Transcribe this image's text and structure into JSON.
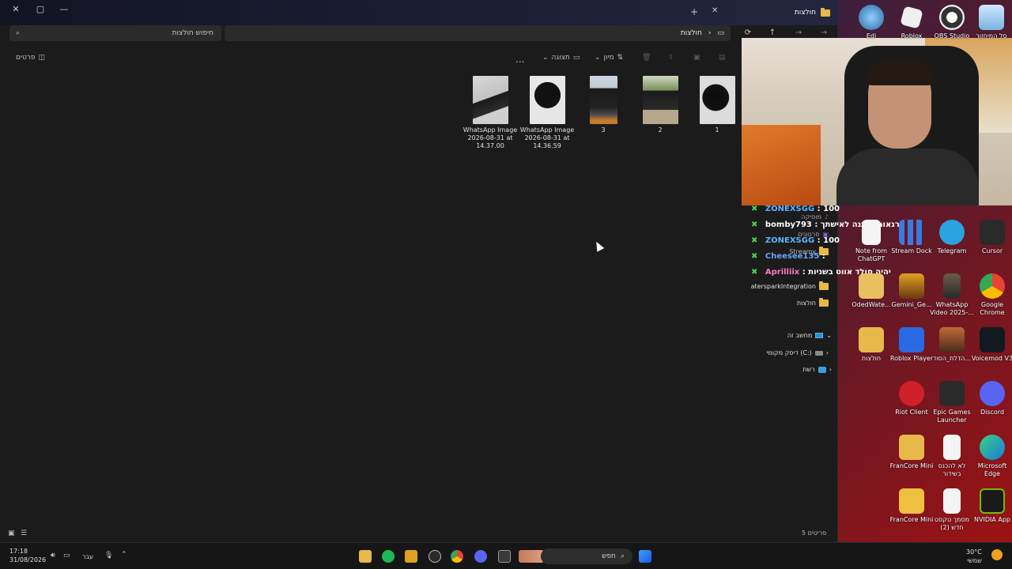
{
  "explorer": {
    "tab_title": "חולצות",
    "search_placeholder": "חיפוש חולצות",
    "address": "חולצות",
    "toolbar": {
      "details": "פרטים",
      "more": "...",
      "view": "תצוגה",
      "sort": "מיון"
    },
    "files": [
      {
        "name": "WhatsApp Image 2026-08-31 at 14.37.00",
        "line1": "WhatsApp Image",
        "line2": "2026-08-31 at",
        "line3": "14.37.00"
      },
      {
        "name": "WhatsApp Image 2026-08-31 at 14.36.59",
        "line1": "WhatsApp Image",
        "line2": "2026-08-31 at",
        "line3": "14.36.59"
      },
      {
        "name": "3",
        "line1": "3",
        "line2": "",
        "line3": ""
      },
      {
        "name": "2",
        "line1": "2",
        "line2": "",
        "line3": ""
      },
      {
        "name": "1",
        "line1": "1",
        "line2": "",
        "line3": ""
      }
    ],
    "nav": {
      "music": "מוסיקה",
      "videos": "סרטונים",
      "streamy": "Streamy",
      "integration": "atersparkIntegration",
      "folder": "חולצות",
      "this_pc": "מחשב זה",
      "local_disk": "דיסק מקומי (C:)",
      "network": "רשת"
    },
    "status": "5 פריטים"
  },
  "chat": [
    {
      "user": "ZONEXSGG",
      "msg": "100"
    },
    {
      "user": "bomby793",
      "msg": "ברגאות איתנה לאישתך"
    },
    {
      "user": "ZONEXSGG",
      "msg": "100"
    },
    {
      "user": "Cheesee135",
      "msg": ""
    },
    {
      "user": "Aprilliix",
      "msg": "יהיה סולד אווט בשניות"
    }
  ],
  "desktop_icons": [
    {
      "label": "סל המיחזור"
    },
    {
      "label": "OBS Studio"
    },
    {
      "label": "Roblox"
    },
    {
      "label": "Edi"
    },
    {
      "label": "Cursor"
    },
    {
      "label": "Telegram"
    },
    {
      "label": "Stream Dock"
    },
    {
      "label": "Note from ChatGPT"
    },
    {
      "label": "Google Chrome"
    },
    {
      "label": "WhatsApp Video 2025-..."
    },
    {
      "label": "Gemini_Ge..."
    },
    {
      "label": "OdedWate..."
    },
    {
      "label": "Voicemod V3"
    },
    {
      "label": "הדלת_הסוד..."
    },
    {
      "label": "Roblox Player"
    },
    {
      "label": "חולצות"
    },
    {
      "label": "Discord"
    },
    {
      "label": "Epic Games Launcher"
    },
    {
      "label": "Riot Client"
    },
    {
      "label": "Microsoft Edge"
    },
    {
      "label": "לא להכנס בשידור"
    },
    {
      "label": "FranCore Mini"
    },
    {
      "label": "NVIDIA App"
    },
    {
      "label": "מסמך טקסט חדש (2)"
    },
    {
      "label": "FranCore Mini"
    }
  ],
  "taskbar": {
    "search": "חפש",
    "lang": "עבר",
    "time": "17:18",
    "date": "31/08/2026",
    "weather_temp": "30°C",
    "weather_desc": "שמשי"
  },
  "colors": {
    "explorer_bg": "#1b1b1b",
    "folder": "#e8b84a",
    "chat_user": "#5ab4ff",
    "desktop_accent": "#a01212"
  }
}
